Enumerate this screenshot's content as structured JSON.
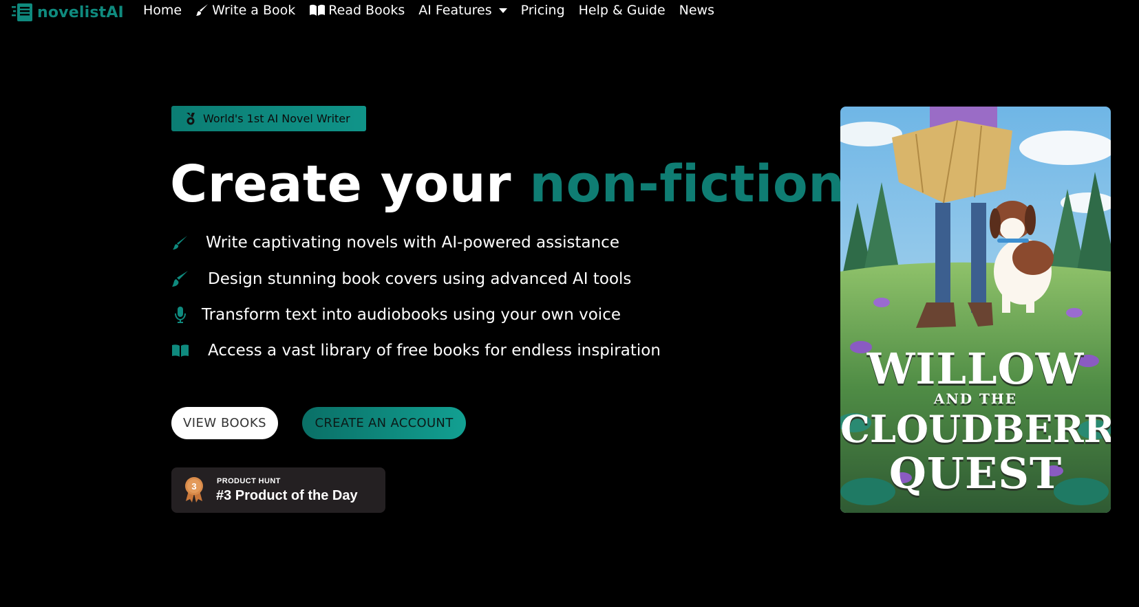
{
  "nav": {
    "brand": "novelistAI",
    "links": [
      {
        "label": "Home",
        "icon": ""
      },
      {
        "label": "Write a Book",
        "icon": "brush-icon"
      },
      {
        "label": "Read Books",
        "icon": "book-open-icon"
      },
      {
        "label": "AI Features",
        "icon": "",
        "dropdown": true
      },
      {
        "label": "Pricing",
        "icon": ""
      },
      {
        "label": "Help & Guide",
        "icon": ""
      },
      {
        "label": "News",
        "icon": ""
      }
    ]
  },
  "hero": {
    "badge": "World's 1st AI Novel Writer",
    "headline_prefix": "Create your",
    "headline_accent": "non-fiction",
    "accent_color": "#0f7d73",
    "features": [
      {
        "text": "Write captivating novels with AI-powered assistance",
        "icon": "pen-icon"
      },
      {
        "text": "Design stunning book covers using advanced AI tools",
        "icon": "paint-brush-icon"
      },
      {
        "text": "Transform text into audiobooks using your own voice",
        "icon": "microphone-icon"
      },
      {
        "text": "Access a vast library of free books for endless inspiration",
        "icon": "book-open-icon"
      }
    ],
    "view_books": "VIEW BOOKS",
    "create_account": "CREATE AN ACCOUNT",
    "product_hunt": {
      "label": "PRODUCT HUNT",
      "title": "#3 Product of the Day",
      "rank": "3"
    }
  },
  "cover": {
    "line1": "WILLOW",
    "line2": "AND THE",
    "line3": "CLOUDBERRY",
    "line4": "QUEST"
  }
}
